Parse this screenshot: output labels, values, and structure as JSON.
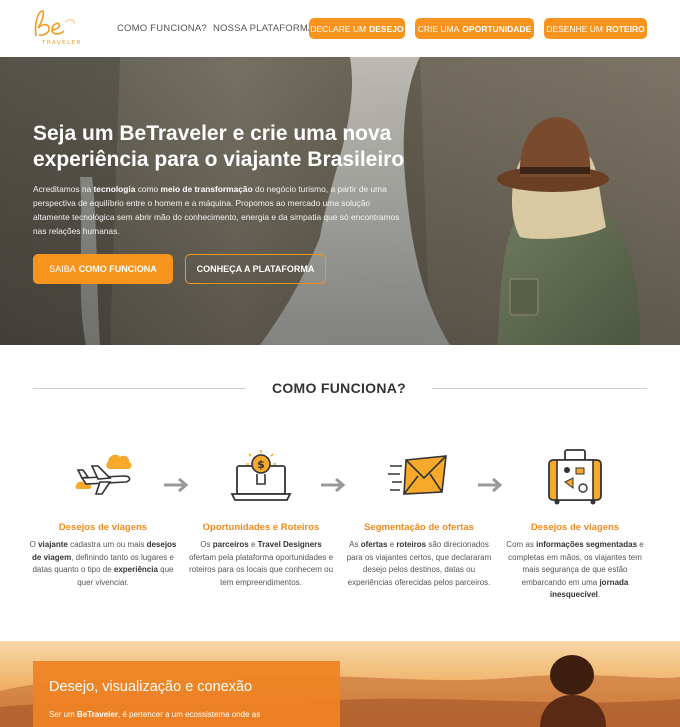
{
  "nav": {
    "logo_text": "TRAVELER",
    "links": [
      "COMO FUNCIONA?",
      "NOSSA PLATAFORMA"
    ],
    "buttons": [
      {
        "pre": "DECLARE UM",
        "bold": "DESEJO"
      },
      {
        "pre": "CRIE UMA",
        "bold": "OPORTUNIDADE"
      },
      {
        "pre": "DESENHE UM",
        "bold": "ROTEIRO"
      }
    ]
  },
  "hero": {
    "title_line1": "Seja um BeTraveler e crie uma nova",
    "title_line2": "experiência para o viajante Brasileiro",
    "p1": "Acreditamos na ",
    "p1_b1": "tecnologia",
    "p2": " como ",
    "p2_b2": "meio de transformação",
    "p3": " do negócio turismo, a partir de uma perspectiva de equilíbrio entre o homem e a máquina. Propomos ao mercado uma solução altamente tecnológica sem abrir mão do conhecimento, energia e da simpatia que só encontramos nas relações humanas.",
    "btn1_pre": "SAIBA",
    "btn1_bold": "COMO FUNCIONA",
    "btn2": "CONHEÇA A PLATAFORMA"
  },
  "how": {
    "title": "COMO FUNCIONA?",
    "steps": [
      {
        "title": "Desejos de viagens",
        "t1": "O ",
        "b1": "viajante",
        "t2": " cadastra um ou mais ",
        "b2": "desejos de viagem",
        "t3": ", definindo tanto os lugares e datas quanto o tipo de ",
        "b3": "experiência",
        "t4": " que quer vivenciar."
      },
      {
        "title": "Oportunidades e Roteiros",
        "t1": "Os ",
        "b1": "parceiros",
        "t2": " e ",
        "b2": "Travel Designers",
        "t3": " ofertam pela plataforma oportunidades e roteiros para os locais que conhecem ou tem empreendimentos.",
        "b3": "",
        "t4": ""
      },
      {
        "title": "Segmentação de ofertas",
        "t1": "As ",
        "b1": "ofertas",
        "t2": " e ",
        "b2": "roteiros",
        "t3": " são direcionados para os viajantes certos, que declararam desejo pelos destinos, datas ou experiências oferecidas pelos parceiros.",
        "b3": "",
        "t4": ""
      },
      {
        "title": "Desejos de viagens",
        "t1": "Com as ",
        "b1": "informações segmentadas",
        "t2": " e completas em mãos, os viajantes tem mais segurança de que estão embarcando em uma ",
        "b2": "jornada inesquecível",
        "t3": ".",
        "b3": "",
        "t4": ""
      }
    ]
  },
  "bottom": {
    "title": "Desejo, visualização e conexão",
    "text_pre": "Ser um ",
    "text_bold": "BeTraveler",
    "text_post": ", é pertencer a um ecossistema onde as"
  },
  "colors": {
    "accent": "#f7941d",
    "step_title": "#f08a1c"
  },
  "icons": [
    "airplane-cloud-icon",
    "laptop-money-icon",
    "envelope-send-icon",
    "suitcase-icon",
    "arrow-right-icon"
  ]
}
